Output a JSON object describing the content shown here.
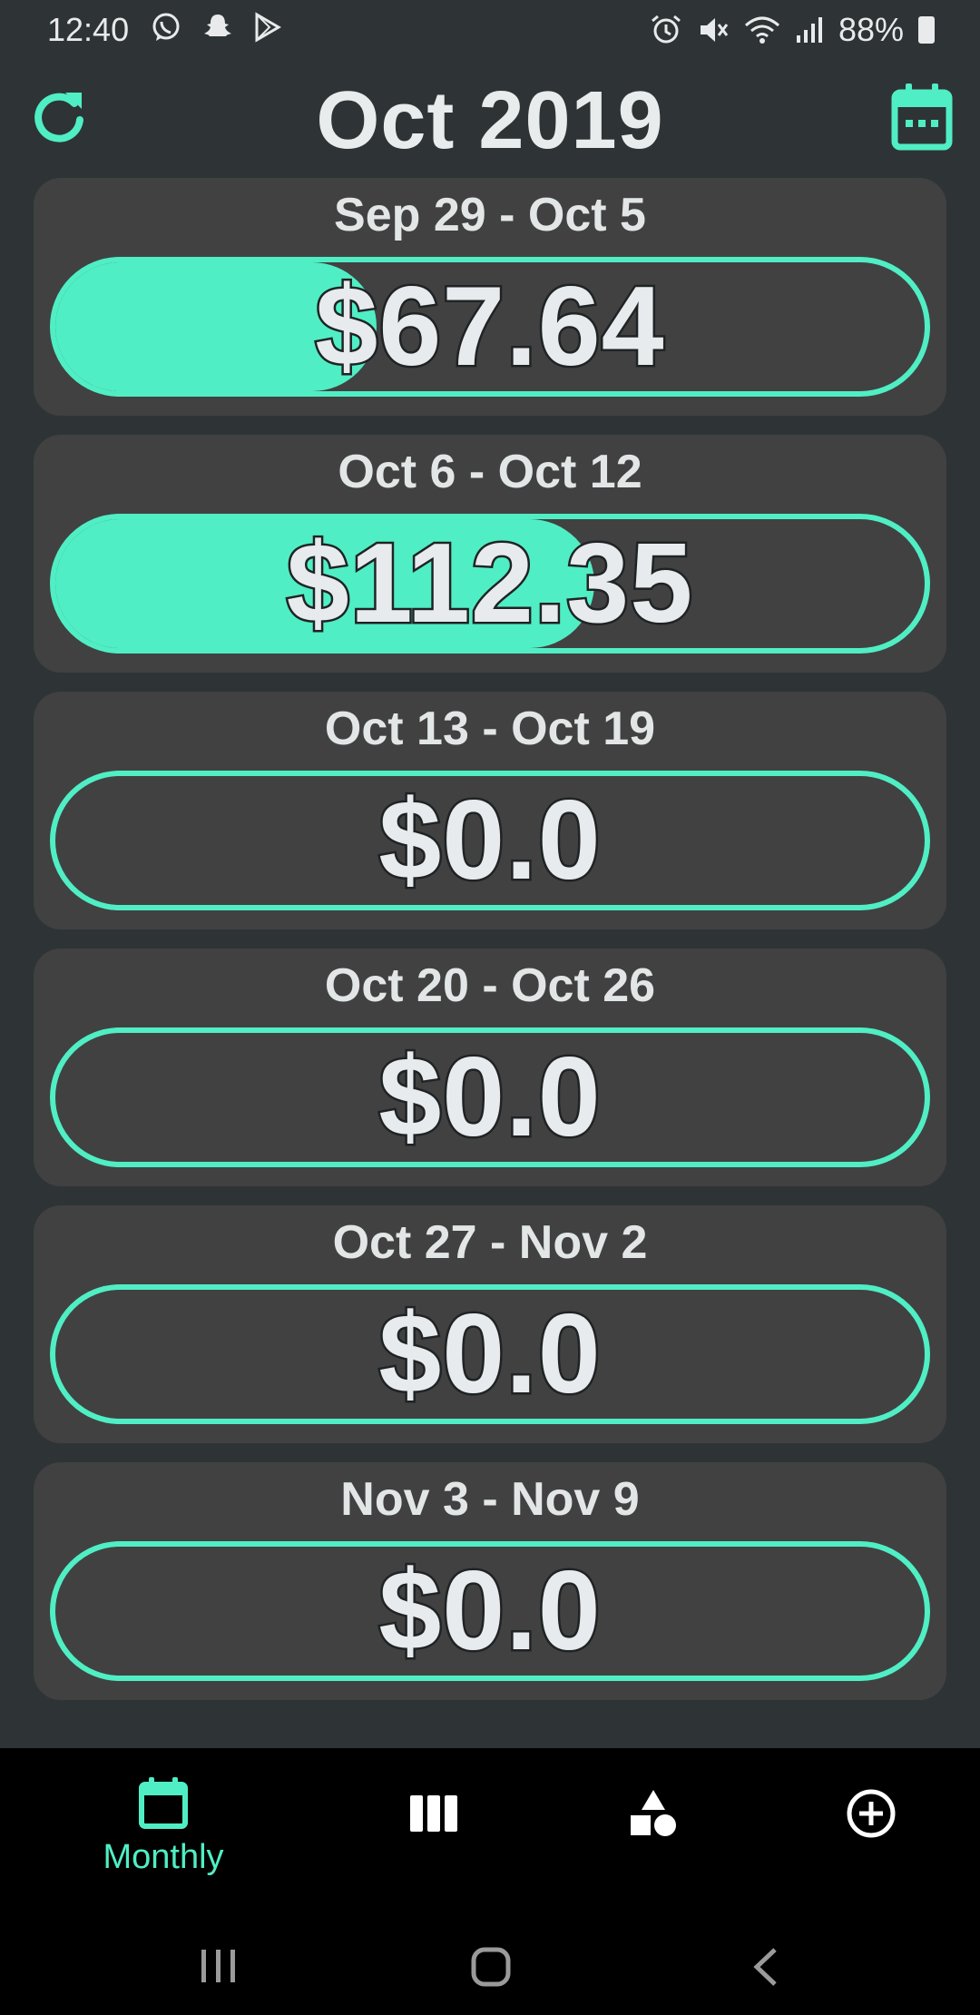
{
  "status_bar": {
    "time": "12:40",
    "left_icons": [
      "whatsapp-icon",
      "snapchat-icon",
      "play-store-icon"
    ],
    "right_icons": [
      "alarm-icon",
      "mute-icon",
      "wifi-icon",
      "signal-icon"
    ],
    "battery": "88%"
  },
  "header": {
    "title": "Oct 2019",
    "refresh_icon": "refresh-icon",
    "calendar_icon": "calendar-icon"
  },
  "weeks": [
    {
      "range": "Sep 29 - Oct 5",
      "amount": "$67.64",
      "fill_fraction": 0.37
    },
    {
      "range": "Oct 6 - Oct 12",
      "amount": "$112.35",
      "fill_fraction": 0.62
    },
    {
      "range": "Oct 13 - Oct 19",
      "amount": "$0.0",
      "fill_fraction": 0
    },
    {
      "range": "Oct 20 - Oct 26",
      "amount": "$0.0",
      "fill_fraction": 0
    },
    {
      "range": "Oct 27 - Nov 2",
      "amount": "$0.0",
      "fill_fraction": 0
    },
    {
      "range": "Nov 3 - Nov 9",
      "amount": "$0.0",
      "fill_fraction": 0
    }
  ],
  "bottom_nav": {
    "items": [
      {
        "icon": "calendar-icon",
        "label": "Monthly",
        "active": true
      },
      {
        "icon": "columns-icon",
        "label": "",
        "active": false
      },
      {
        "icon": "shapes-icon",
        "label": "",
        "active": false
      },
      {
        "icon": "add-circle-icon",
        "label": "",
        "active": false
      }
    ]
  },
  "colors": {
    "accent": "#50eec4",
    "background": "#2e3435",
    "card": "#414141",
    "text": "#e7ebee"
  }
}
